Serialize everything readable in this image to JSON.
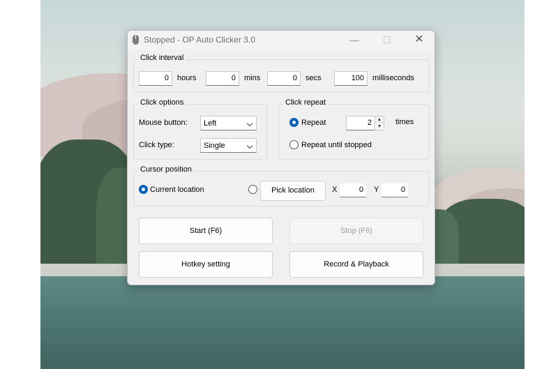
{
  "window": {
    "title": "Stopped - OP Auto Clicker 3.0",
    "controls": {
      "minimize": "—",
      "close": "✕"
    }
  },
  "click_interval": {
    "legend": "Click interval",
    "hours_value": "0",
    "hours_label": "hours",
    "mins_value": "0",
    "mins_label": "mins",
    "secs_value": "0",
    "secs_label": "secs",
    "ms_value": "100",
    "ms_label": "milliseconds"
  },
  "click_options": {
    "legend": "Click options",
    "mouse_button_label": "Mouse button:",
    "mouse_button_value": "Left",
    "click_type_label": "Click type:",
    "click_type_value": "Single"
  },
  "click_repeat": {
    "legend": "Click repeat",
    "repeat_label": "Repeat",
    "repeat_selected": true,
    "repeat_count": "2",
    "times_label": "times",
    "until_stopped_label": "Repeat until stopped"
  },
  "cursor_position": {
    "legend": "Cursor position",
    "current_location_label": "Current location",
    "current_location_selected": true,
    "pick_location_label": "Pick location",
    "x_label": "X",
    "x_value": "0",
    "y_label": "Y",
    "y_value": "0"
  },
  "actions": {
    "start_label": "Start (F6)",
    "stop_label": "Stop (F6)",
    "hotkey_label": "Hotkey setting",
    "record_label": "Record & Playback"
  },
  "icons": [
    "mouse-icon",
    "minimize-icon",
    "maximize-icon",
    "close-icon",
    "chevron-down-icon",
    "spin-up-icon",
    "spin-down-icon"
  ]
}
